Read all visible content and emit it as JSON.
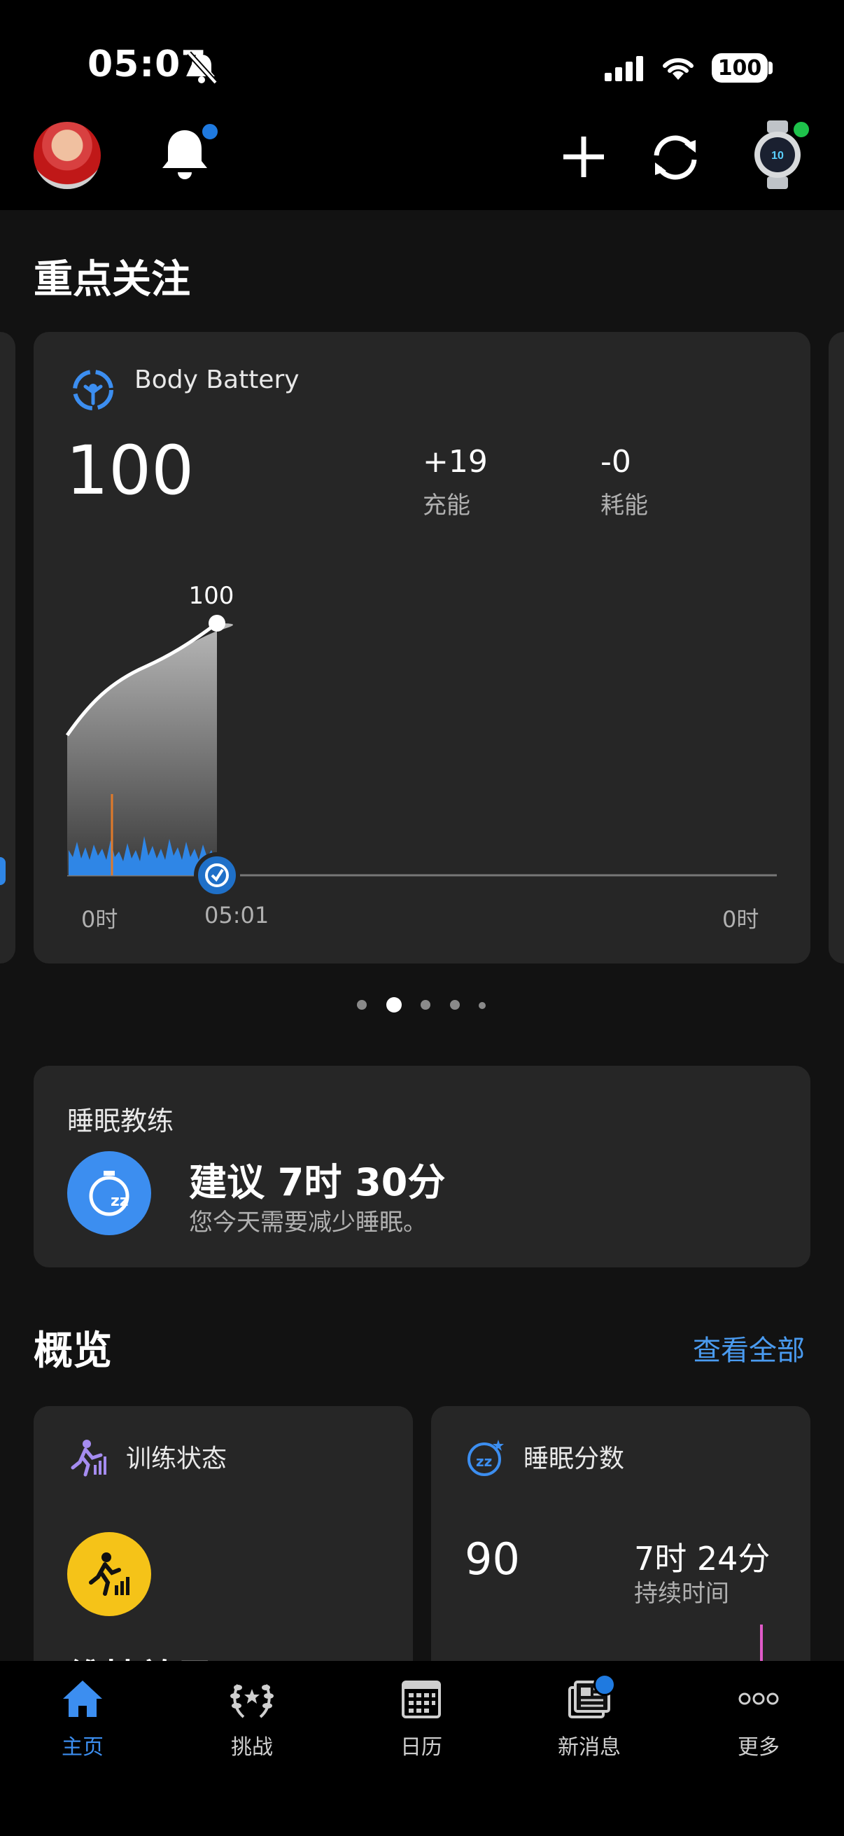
{
  "status_bar": {
    "time": "05:07",
    "battery": "100"
  },
  "header": {
    "notification_dot": true,
    "device_connected": true
  },
  "highlights": {
    "title": "重点关注",
    "body_battery": {
      "title": "Body Battery",
      "value": "100",
      "charged_value": "+19",
      "charged_label": "充能",
      "drained_value": "-0",
      "drained_label": "耗能",
      "peak_label": "100",
      "x_start": "0时",
      "x_now": "05:01",
      "x_end": "0时"
    },
    "pager": {
      "count": 5,
      "active": 1
    }
  },
  "sleep_coach": {
    "title": "睡眠教练",
    "headline": "建议 7时 30分",
    "subtitle": "您今天需要减少睡眠。"
  },
  "overview": {
    "title": "概览",
    "view_all": "查看全部",
    "training_status": {
      "title": "训练状态",
      "partial_text": "维持效果"
    },
    "sleep_score": {
      "title": "睡眠分数",
      "score": "90",
      "duration": "7时 24分",
      "duration_label": "持续时间"
    }
  },
  "bottom_nav": {
    "items": [
      {
        "label": "主页",
        "icon": "home-icon",
        "active": true
      },
      {
        "label": "挑战",
        "icon": "laurel-icon",
        "active": false
      },
      {
        "label": "日历",
        "icon": "calendar-icon",
        "active": false
      },
      {
        "label": "新消息",
        "icon": "news-icon",
        "active": false
      },
      {
        "label": "更多",
        "icon": "more-icon",
        "active": false
      }
    ]
  },
  "colors": {
    "accent": "#3c8ef0",
    "battery_blue": "#2f86e6",
    "yellow": "#f5c318",
    "card": "#262626"
  }
}
